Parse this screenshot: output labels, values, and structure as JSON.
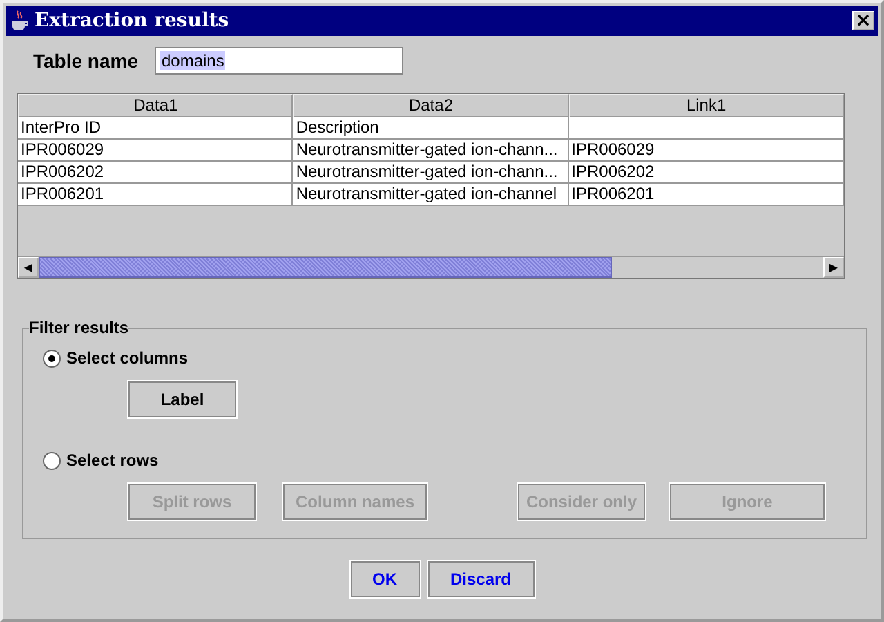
{
  "window": {
    "title": "Extraction results",
    "close": "×"
  },
  "table_name": {
    "label": "Table name",
    "value": "domains",
    "text_selected": true
  },
  "table": {
    "columns": [
      "Data1",
      "Data2",
      "Link1"
    ],
    "rows": [
      [
        "InterPro ID",
        "Description",
        ""
      ],
      [
        "IPR006029",
        "Neurotransmitter-gated ion-chann...",
        "IPR006029"
      ],
      [
        "IPR006202",
        "Neurotransmitter-gated ion-chann...",
        "IPR006202"
      ],
      [
        "IPR006201",
        "Neurotransmitter-gated ion-channel",
        "IPR006201"
      ]
    ],
    "scroll_left": "◀",
    "scroll_right": "▶"
  },
  "filter": {
    "title": "Filter results",
    "options": [
      {
        "label": "Select columns",
        "selected": true,
        "buttons": [
          {
            "label": "Label",
            "disabled": false
          }
        ]
      },
      {
        "label": "Select rows",
        "selected": false,
        "buttons": [
          {
            "label": "Split rows",
            "disabled": true
          },
          {
            "label": "Column names",
            "disabled": true
          },
          {
            "label": "Consider only",
            "disabled": true
          },
          {
            "label": "Ignore",
            "disabled": true
          }
        ]
      }
    ]
  },
  "buttons": [
    {
      "label": "OK",
      "disabled": false
    },
    {
      "label": "Discard",
      "disabled": false
    }
  ]
}
